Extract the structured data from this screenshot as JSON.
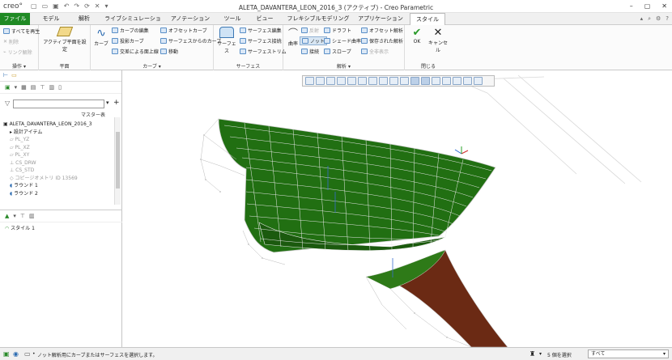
{
  "app": {
    "logo": "creo°",
    "title": "ALETA_DAVANTERA_LEON_2016_3 (アクティブ) - Creo Parametric"
  },
  "tabs": [
    "ファイル",
    "モデル",
    "解析",
    "ライブシミュレーション",
    "アノテーション",
    "ツール",
    "ビュー",
    "フレキシブルモデリング",
    "アプリケーション",
    "スタイル"
  ],
  "ribbon": {
    "ops": {
      "items": [
        "すべてを再生",
        "削除",
        "リンク解除"
      ],
      "label": "操作 ▾"
    },
    "plane": {
      "item": "アクティブ平面を設定",
      "label": "平面"
    },
    "curve": {
      "big": "カーブ",
      "items": [
        "カーブの編集",
        "投影カーブ",
        "交差による面上線",
        "オフセットカーブ",
        "サーフェスからのカーブ",
        "移動"
      ],
      "label": "カーブ ▾"
    },
    "surface": {
      "big": "サーフェス",
      "items": [
        "サーフェス編集",
        "サーフェス接続",
        "サーフェストリム"
      ],
      "label": "サーフェス"
    },
    "analysis": {
      "big": "曲率",
      "items": [
        "反射",
        "ノット",
        "接続",
        "ドラフト",
        "シェード曲率",
        "スロープ",
        "オフセット解析",
        "保存された解析",
        "全非表示"
      ],
      "label": "解析 ▾"
    },
    "close": {
      "ok": "OK",
      "cancel": "キャンセル",
      "label": "閉じる"
    }
  },
  "tree": {
    "master": "マスター表",
    "items": [
      "ALETA_DAVANTERA_LEON_2016_3",
      "設計アイテム",
      "PL_YZ",
      "PL_XZ",
      "PL_XY",
      "CS_DRW",
      "CS_STD",
      "コピージオメトリ ID 13569",
      "ラウンド 1",
      "ラウンド 2"
    ],
    "style_item": "スタイル 1"
  },
  "status": {
    "msg": "ノット解析用にカーブまたはサーフェスを選択します。",
    "selected": "5 個を選択",
    "filter": "すべて"
  },
  "colors": {
    "accent": "#1f8a24",
    "surface": "#1d6a10",
    "dark": "#6b2a14"
  }
}
